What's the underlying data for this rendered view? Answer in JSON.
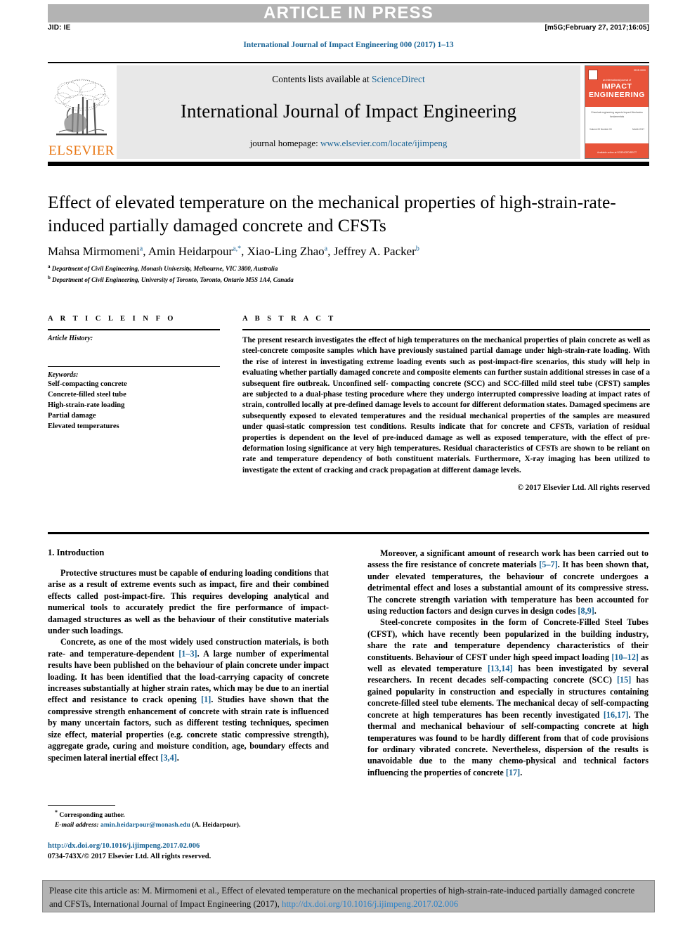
{
  "banner": {
    "article_in_press": "ARTICLE IN PRESS",
    "jid": "JID: IE",
    "build_stamp": "[m5G;February 27, 2017;16:05]",
    "journal_ref_line": "International Journal of Impact Engineering 000 (2017) 1–13"
  },
  "masthead": {
    "contents_prefix": "Contents lists available at ",
    "sciencedirect": "ScienceDirect",
    "journal_title": "International Journal of Impact Engineering",
    "homepage_prefix": "journal homepage: ",
    "homepage_url": "www.elsevier.com/locate/ijimpeng",
    "publisher": "ELSEVIER",
    "cover": {
      "issue": "ISSN 0000",
      "subtitle": "an international journal of",
      "title_line1": "IMPACT",
      "title_line2": "ENGINEERING",
      "body_lines": "Chemical\nengineering aspects\n\nImpact Mechanics\nfundamentals",
      "col_left": "Volume 00\nNumber 00",
      "col_right": "Month\n2017",
      "footer": "Available online at\nSCIENCEDIRECT"
    }
  },
  "article": {
    "title": "Effect of elevated temperature on the mechanical properties of high-strain-rate-induced partially damaged concrete and CFSTs",
    "authors": [
      {
        "name": "Mahsa Mirmomeni",
        "marks": "a"
      },
      {
        "name": "Amin Heidarpour",
        "marks": "a,*"
      },
      {
        "name": "Xiao-Ling Zhao",
        "marks": "a"
      },
      {
        "name": "Jeffrey A. Packer",
        "marks": "b"
      }
    ],
    "affiliations": [
      {
        "mark": "a",
        "text": "Department of Civil Engineering, Monash University, Melbourne, VIC 3800, Australia"
      },
      {
        "mark": "b",
        "text": "Department of Civil Engineering, University of Toronto, Toronto, Ontario M5S 1A4, Canada"
      }
    ]
  },
  "info": {
    "heading": "A R T I C L E   I N F O",
    "history_label": "Article History:",
    "keywords_label": "Keywords:",
    "keywords": [
      "Self-compacting concrete",
      "Concrete-filled steel tube",
      "High-strain-rate loading",
      "Partial damage",
      "Elevated temperatures"
    ]
  },
  "abstract": {
    "heading": "A B S T R A C T",
    "body": "The present research investigates the effect of high temperatures on the mechanical properties of plain concrete as well as steel-concrete composite samples which have previously sustained partial damage under high-strain-rate loading. With the rise of interest in investigating extreme loading events such as post-impact-fire scenarios, this study will help in evaluating whether partially damaged concrete and composite elements can further sustain additional stresses in case of a subsequent fire outbreak. Unconfined self- compacting concrete (SCC) and SCC-filled mild steel tube (CFST) samples are subjected to a dual-phase testing procedure where they undergo interrupted compressive loading at impact rates of strain, controlled locally at pre-defined damage levels to account for different deformation states. Damaged specimens are subsequently exposed to elevated temperatures and the residual mechanical properties of the samples are measured under quasi-static compression test conditions. Results indicate that for concrete and CFSTs, variation of residual properties is dependent on the level of pre-induced damage as well as exposed temperature, with the effect of pre-deformation losing significance at very high temperatures. Residual characteristics of CFSTs are shown to be reliant on rate and temperature dependency of both constituent materials. Furthermore, X-ray imaging has been utilized to investigate the extent of cracking and crack propagation at different damage levels.",
    "copyright": "© 2017 Elsevier Ltd. All rights reserved"
  },
  "body": {
    "intro_heading": "1. Introduction",
    "left_paragraphs": [
      "Protective structures must be capable of enduring loading conditions that arise as a result of extreme events such as impact, fire and their combined effects called post-impact-fire. This requires developing analytical and numerical tools to accurately predict the fire performance of impact-damaged structures as well as the behaviour of their constitutive materials under such loadings."
    ],
    "left_p2_a": "Concrete, as one of the most widely used construction materials, is both rate- and temperature-dependent ",
    "left_p2_r1": "[1–3]",
    "left_p2_b": ". A large number of experimental results have been published on the behaviour of plain concrete under impact loading. It has been identified that the load-carrying capacity of concrete increases substantially at higher strain rates, which may be due to an inertial effect and resistance to crack opening ",
    "left_p2_r2": "[1]",
    "left_p2_c": ". Studies have shown that the compressive strength enhancement of concrete with strain rate is influenced by many uncertain factors, such as different testing techniques, specimen size effect, material properties (e.g. concrete static compressive strength), aggregate grade, curing and moisture condition, age, boundary effects and specimen lateral inertial effect ",
    "left_p2_r3": "[3,4]",
    "left_p2_d": ".",
    "right_p1_a": "Moreover, a significant amount of research work has been carried out to assess the fire resistance of concrete materials ",
    "right_p1_r1": "[5–7]",
    "right_p1_b": ". It has been shown that, under elevated temperatures, the behaviour of concrete undergoes a detrimental effect and loses a substantial amount of its compressive stress. The concrete strength variation with temperature has been accounted for using reduction factors and design curves in design codes ",
    "right_p1_r2": "[8,9]",
    "right_p1_c": ".",
    "right_p2_a": "Steel-concrete composites in the form of Concrete-Filled Steel Tubes (CFST), which have recently been popularized in the building industry, share the rate and temperature dependency characteristics of their constituents. Behaviour of CFST under high speed impact loading ",
    "right_p2_r1": "[10–12]",
    "right_p2_b": " as well as elevated temperature ",
    "right_p2_r2": "[13,14]",
    "right_p2_c": " has been investigated by several researchers. In recent decades self-compacting concrete (SCC) ",
    "right_p2_r3": "[15]",
    "right_p2_d": " has gained popularity in construction and especially in structures containing concrete-filled steel tube elements. The mechanical decay of self-compacting concrete at high temperatures has been recently investigated ",
    "right_p2_r4": "[16,17]",
    "right_p2_e": ". The thermal and mechanical behaviour of self-compacting concrete at high temperatures was found to be hardly different from that of code provisions for ordinary vibrated concrete. Nevertheless, dispersion of the results is unavoidable due to the many chemo-physical and technical factors influencing the properties of concrete ",
    "right_p2_r5": "[17]",
    "right_p2_f": "."
  },
  "footnote": {
    "star": "*",
    "corresponding": "Corresponding author.",
    "email_label": "E-mail address:",
    "email": "amin.heidarpour@monash.edu",
    "email_owner": "(A. Heidarpour).",
    "doi": "http://dx.doi.org/10.1016/j.ijimpeng.2017.02.006",
    "issn_line": "0734-743X/© 2017 Elsevier Ltd. All rights reserved."
  },
  "cite": {
    "prefix": "Please cite this article as: M. Mirmomeni et al., Effect of elevated temperature on the mechanical properties of high-strain-rate-induced partially damaged concrete and CFSTs, International Journal of Impact Engineering (2017), ",
    "link": "http://dx.doi.org/10.1016/j.ijimpeng.2017.02.006"
  },
  "colors": {
    "link_blue": "#1a6496",
    "cite_link_blue": "#2b82c9",
    "banner_gray": "#b3b3b3",
    "elsevier_orange": "#e87511",
    "cover_red": "#e8543a"
  }
}
